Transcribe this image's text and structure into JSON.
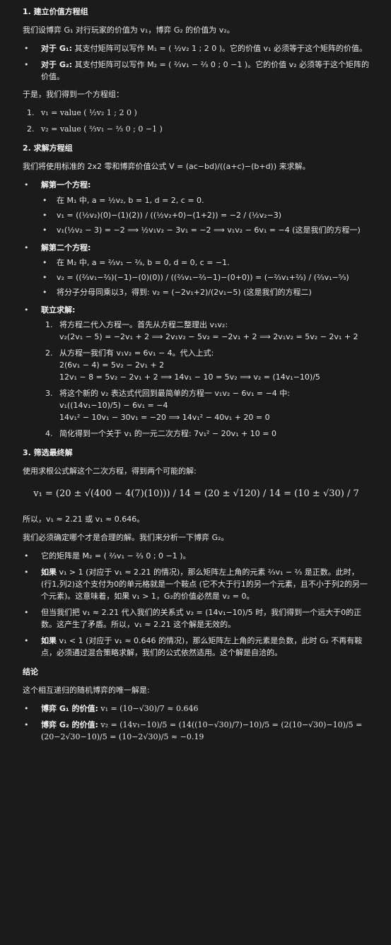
{
  "s1": {
    "heading": "1. 建立价值方程组",
    "intro": "我们设博弈 G₁ 对行玩家的价值为 v₁，博弈 G₂ 的价值为 v₂。",
    "b1_label": "对于 G₁:",
    "b1_text": "其支付矩阵可以写作 M₁ = ( ½v₂ 1 ; 2 0 )。它的价值 v₁ 必须等于这个矩阵的价值。",
    "b2_label": "对于 G₂:",
    "b2_text": "其支付矩阵可以写作 M₂ = ( ⅔v₁ − ⅔ 0 ; 0 −1 )。它的价值 v₂ 必须等于这个矩阵的价值。",
    "system_intro": "于是，我们得到一个方程组：",
    "eq1": "v₁ = value ( ½v₂ 1 ; 2 0 )",
    "eq2": "v₂ = value ( ⅔v₁ − ⅔ 0 ; 0 −1 )"
  },
  "s2": {
    "heading": "2. 求解方程组",
    "intro": "我们将使用标准的 2x2 零和博弈价值公式 V = (ac−bd)/((a+c)−(b+d)) 来求解。",
    "first_label": "解第一个方程:",
    "first": [
      "在 M₁ 中, a = ½v₂, b = 1, d = 2, c = 0.",
      "v₁ = ((½v₂)(0)−(1)(2)) / ((½v₂+0)−(1+2)) = −2 / (½v₂−3)",
      "v₁(½v₂ − 3) = −2 ⟹ ½v₁v₂ − 3v₁ = −2 ⟹ v₁v₂ − 6v₁ = −4 (这是我们的方程一)"
    ],
    "second_label": "解第二个方程:",
    "second": [
      "在 M₂ 中, a = ⅔v₁ − ⅔, b = 0, d = 0, c = −1.",
      "v₂ = ((⅔v₁−⅔)(−1)−(0)(0)) / ((⅔v₁−⅔−1)−(0+0)) = (−⅔v₁+⅔) / (⅔v₁−⁵⁄₃)",
      "将分子分母同乘以3，得到: v₂ = (−2v₁+2)/(2v₁−5) (这是我们的方程二)"
    ],
    "joint_label": "联立求解:",
    "steps": [
      "将方程二代入方程一。首先从方程二整理出 v₁v₂:",
      "v₂(2v₁ − 5) = −2v₁ + 2 ⟹ 2v₁v₂ − 5v₂ = −2v₁ + 2 ⟹ 2v₁v₂ = 5v₂ − 2v₁ + 2",
      "从方程一我们有 v₁v₂ = 6v₁ − 4。代入上式:",
      "2(6v₁ − 4) = 5v₂ − 2v₁ + 2",
      "12v₁ − 8 = 5v₂ − 2v₁ + 2 ⟹ 14v₁ − 10 = 5v₂ ⟹ v₂ = (14v₁−10)/5",
      "将这个新的 v₂ 表达式代回到最简单的方程一 v₁v₂ − 6v₁ = −4 中:",
      "v₁((14v₁−10)/5) − 6v₁ = −4",
      "14v₁² − 10v₁ − 30v₁ = −20 ⟹ 14v₁² − 40v₁ + 20 = 0",
      "简化得到一个关于 v₁ 的一元二次方程: 7v₁² − 20v₁ + 10 = 0"
    ]
  },
  "s3": {
    "heading": "3. 筛选最终解",
    "intro": "使用求根公式解这个二次方程，得到两个可能的解:",
    "formula": "v₁ = (20 ± √(400 − 4(7)(10))) / 14 = (20 ± √120) / 14 = (10 ± √30) / 7",
    "approx": "所以，v₁ ≈ 2.21 或 v₁ ≈ 0.646。",
    "check_intro": "我们必须确定哪个才是合理的解。我们来分析一下博弈 G₂。",
    "b1": "它的矩阵是 M₂ = ( ⅔v₁ − ⅔ 0 ; 0 −1 )。",
    "b2_label": "如果",
    "b2": "v₁ > 1 (对应于 v₁ ≈ 2.21 的情况)，那么矩阵左上角的元素 ⅔v₁ − ⅔ 是正数。此时，(行1,列2)这个支付为0的单元格就是一个鞍点 (它不大于行1的另一个元素，且不小于列2的另一个元素)。这意味着，如果 v₁ > 1，G₂的价值必然是 v₂ = 0。",
    "b3": "但当我们把 v₁ ≈ 2.21 代入我们的关系式 v₂ = (14v₁−10)/5 时，我们得到一个远大于0的正数。这产生了矛盾。所以，v₁ ≈ 2.21 这个解是无效的。",
    "b4_label": "如果",
    "b4": "v₁ < 1 (对应于 v₁ ≈ 0.646 的情况)，那么矩阵左上角的元素是负数，此时 G₂ 不再有鞍点，必须通过混合策略求解，我们的公式依然适用。这个解是自洽的。"
  },
  "conclusion": {
    "heading": "结论",
    "intro": "这个相互递归的随机博弈的唯一解是:",
    "g1_label": "博弈 G₁ 的价值:",
    "g1": "v₁ = (10−√30)/7 ≈ 0.646",
    "g2_label": "博弈 G₂ 的价值:",
    "g2": "v₂ = (14v₁−10)/5 = (14((10−√30)/7)−10)/5 = (2(10−√30)−10)/5 = (20−2√30−10)/5 = (10−2√30)/5 ≈ −0.19"
  }
}
